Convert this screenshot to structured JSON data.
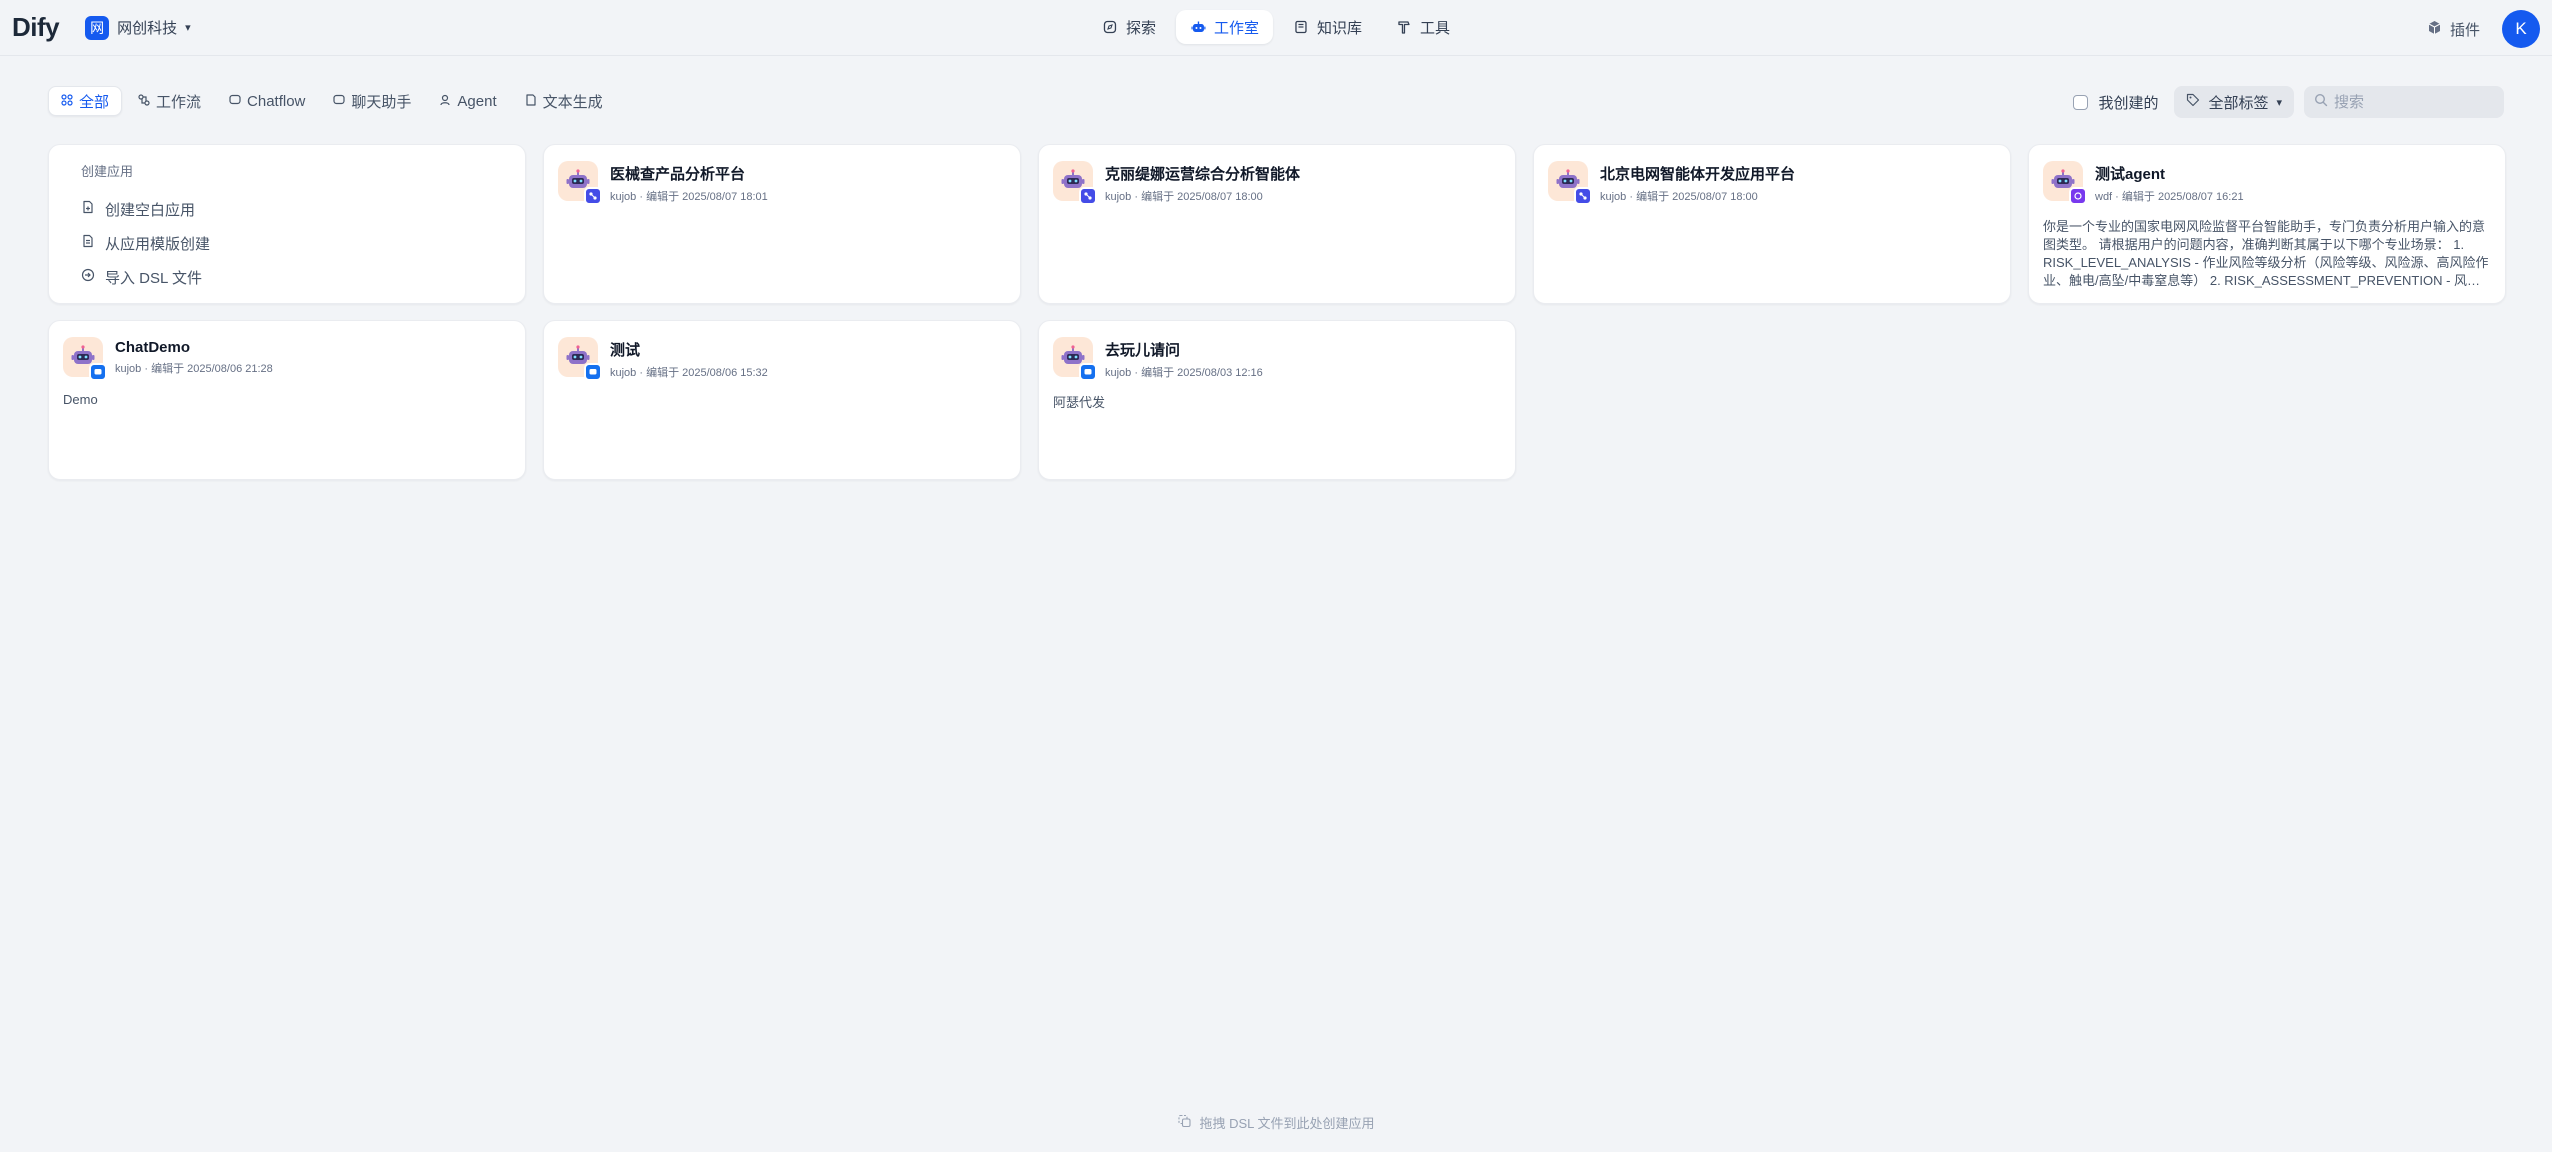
{
  "header": {
    "logo": "Dify",
    "workspace_badge": "网",
    "workspace_name": "网创科技",
    "nav": [
      {
        "label": "探索",
        "icon": "compass-icon",
        "active": false
      },
      {
        "label": "工作室",
        "icon": "robot-icon",
        "active": true
      },
      {
        "label": "知识库",
        "icon": "book-icon",
        "active": false
      },
      {
        "label": "工具",
        "icon": "hammer-icon",
        "active": false
      }
    ],
    "plugin_label": "插件",
    "avatar_initial": "K"
  },
  "filters": {
    "tabs": [
      {
        "label": "全部",
        "active": true
      },
      {
        "label": "工作流",
        "active": false
      },
      {
        "label": "Chatflow",
        "active": false
      },
      {
        "label": "聊天助手",
        "active": false
      },
      {
        "label": "Agent",
        "active": false
      },
      {
        "label": "文本生成",
        "active": false
      }
    ],
    "created_by_me": "我创建的",
    "tag_select": "全部标签",
    "search_placeholder": "搜索"
  },
  "create_card": {
    "title": "创建应用",
    "items": [
      "创建空白应用",
      "从应用模版创建",
      "导入 DSL 文件"
    ]
  },
  "apps": [
    {
      "name": "医械查产品分析平台",
      "meta": "kujob · 编辑于 2025/08/07 18:01",
      "desc": "",
      "type": "workflow"
    },
    {
      "name": "克丽缇娜运营综合分析智能体",
      "meta": "kujob · 编辑于 2025/08/07 18:00",
      "desc": "",
      "type": "workflow"
    },
    {
      "name": "北京电网智能体开发应用平台",
      "meta": "kujob · 编辑于 2025/08/07 18:00",
      "desc": "",
      "type": "workflow"
    },
    {
      "name": "测试agent",
      "meta": "wdf · 编辑于 2025/08/07 16:21",
      "desc": "你是一个专业的国家电网风险监督平台智能助手，专门负责分析用户输入的意图类型。 请根据用户的问题内容，准确判断其属于以下哪个专业场景： 1. RISK_LEVEL_ANALYSIS - 作业风险等级分析（风险等级、风险源、高风险作业、触电/高坠/中毒窒息等） 2. RISK_ASSESSMENT_PREVENTION - 风险点评估及防范...",
      "type": "agent"
    },
    {
      "name": "ChatDemo",
      "meta": "kujob · 编辑于 2025/08/06 21:28",
      "desc": "Demo",
      "type": "chat"
    },
    {
      "name": "测试",
      "meta": "kujob · 编辑于 2025/08/06 15:32",
      "desc": "",
      "type": "chat"
    },
    {
      "name": "去玩儿请问",
      "meta": "kujob · 编辑于 2025/08/03 12:16",
      "desc": "阿瑟代发",
      "type": "chat"
    }
  ],
  "footer_hint": "拖拽 DSL 文件到此处创建应用"
}
